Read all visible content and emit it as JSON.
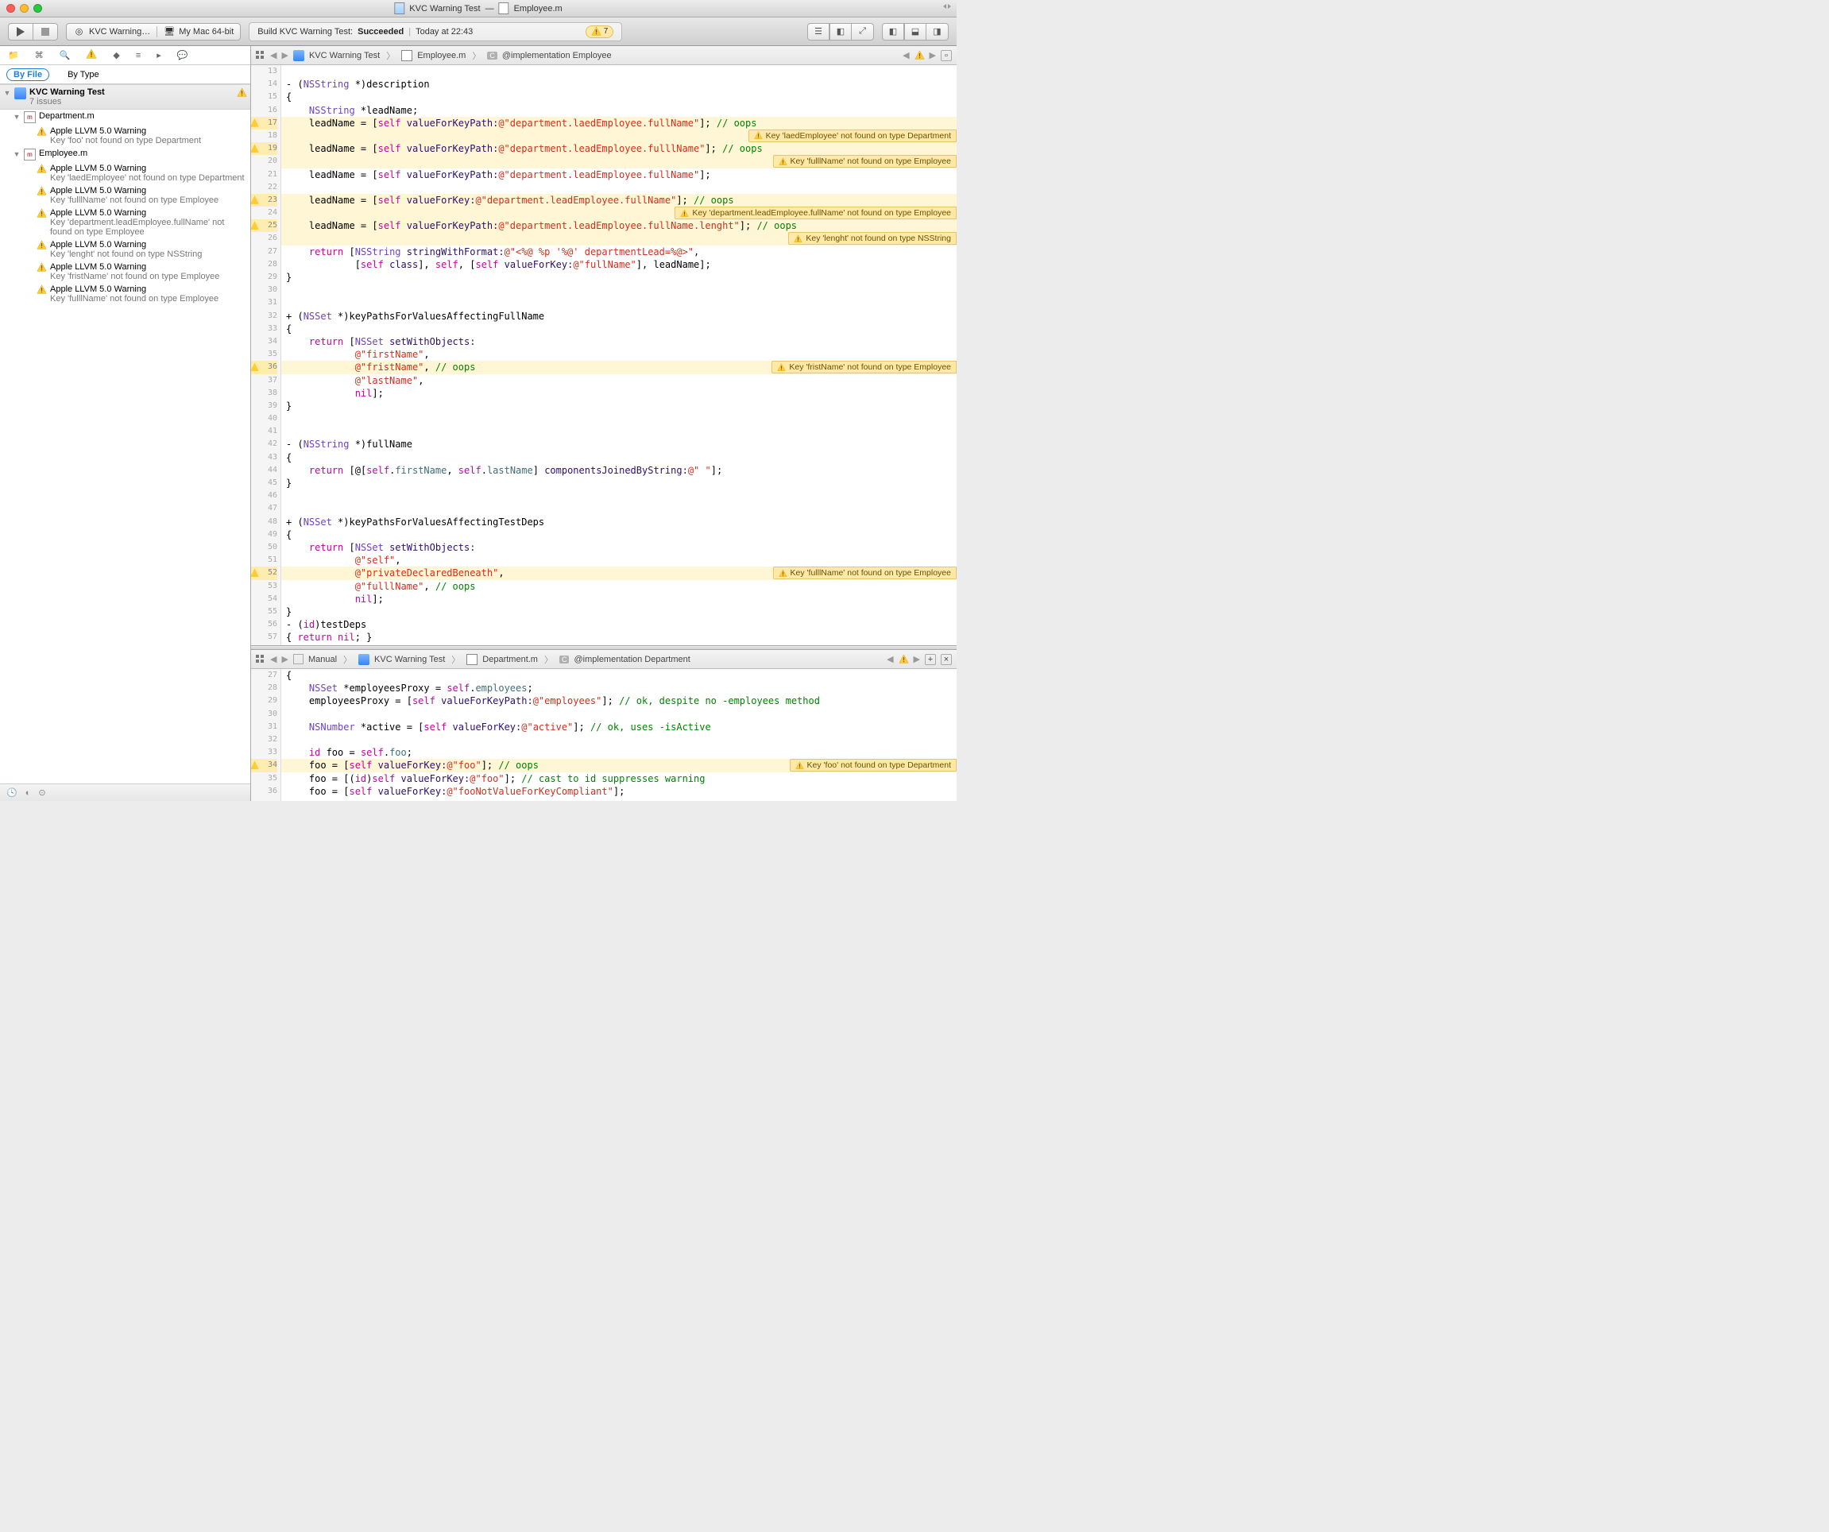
{
  "title": {
    "project": "KVC Warning Test",
    "dash": " — ",
    "file": "Employee.m"
  },
  "toolbar": {
    "scheme": "KVC Warning…",
    "destination": "My Mac 64-bit",
    "activity_prefix": "Build KVC Warning Test: ",
    "activity_status": "Succeeded",
    "activity_time": "Today at 22:43",
    "warn_count": "7"
  },
  "filters": {
    "by_file": "By File",
    "by_type": "By Type"
  },
  "sidebar": {
    "project": "KVC Warning Test",
    "issues": "7 issues",
    "files": [
      {
        "name": "Department.m",
        "items": [
          {
            "title": "Apple LLVM 5.0 Warning",
            "detail": "Key 'foo' not found on type Department"
          }
        ]
      },
      {
        "name": "Employee.m",
        "items": [
          {
            "title": "Apple LLVM 5.0 Warning",
            "detail": "Key 'laedEmployee' not found on type Department"
          },
          {
            "title": "Apple LLVM 5.0 Warning",
            "detail": "Key 'fulllName' not found on type Employee"
          },
          {
            "title": "Apple LLVM 5.0 Warning",
            "detail": "Key 'department.leadEmployee.fullName' not found on type Employee"
          },
          {
            "title": "Apple LLVM 5.0 Warning",
            "detail": "Key 'lenght' not found on type NSString"
          },
          {
            "title": "Apple LLVM 5.0 Warning",
            "detail": "Key 'fristName' not found on type Employee"
          },
          {
            "title": "Apple LLVM 5.0 Warning",
            "detail": "Key 'fulllName' not found on type Employee"
          }
        ]
      }
    ]
  },
  "jump1": {
    "project": "KVC Warning Test",
    "file": "Employee.m",
    "symbol": "@implementation Employee"
  },
  "jump2": {
    "mode": "Manual",
    "project": "KVC Warning Test",
    "file": "Department.m",
    "symbol": "@implementation Department"
  },
  "inline": {
    "w17": "Key 'laedEmployee' not found on type Department",
    "w19": "Key 'fulllName' not found on type Employee",
    "w23": "Key 'department.leadEmployee.fullName' not found on type Employee",
    "w25": "Key 'lenght' not found on type NSString",
    "w36": "Key 'fristName' not found on type Employee",
    "w52": "Key 'fulllName' not found on type Employee",
    "w34b": "Key 'foo' not found on type Department"
  },
  "editor1": {
    "start": 13,
    "lines": [
      "",
      "- (<cls>NSString</cls> *)description",
      "{",
      "    <cls>NSString</cls> *leadName;",
      "    leadName = [<selfc>self</selfc> <msg>valueForKeyPath:</msg><str>@\"department.laedEmployee.fullName\"</str>]; <cmt>// oops</cmt>",
      "",
      "    leadName = [<selfc>self</selfc> <msg>valueForKeyPath:</msg><str>@\"department.leadEmployee.fulllName\"</str>]; <cmt>// oops</cmt>",
      "",
      "    leadName = [<selfc>self</selfc> <msg>valueForKeyPath:</msg><str>@\"department.leadEmployee.fullName\"</str>];",
      "",
      "    leadName = [<selfc>self</selfc> <msg>valueForKey:</msg><str>@\"department.leadEmployee.fullName\"</str>]; <cmt>// oops</cmt>",
      "",
      "    leadName = [<selfc>self</selfc> <msg>valueForKeyPath:</msg><str>@\"department.leadEmployee.fullName.lenght\"</str>]; <cmt>// oops</cmt>",
      "",
      "    <kw>return</kw> [<cls>NSString</cls> <msg>stringWithFormat:</msg><str>@\"&lt;%@ %p '%@' departmentLead=%@&gt;\"</str>,",
      "            [<selfc>self</selfc> <msg>class</msg>], <selfc>self</selfc>, [<selfc>self</selfc> <msg>valueForKey:</msg><str>@\"fullName\"</str>], leadName];",
      "}",
      "",
      "",
      "+ (<cls>NSSet</cls> *)keyPathsForValuesAffectingFullName",
      "{",
      "    <kw>return</kw> [<cls>NSSet</cls> <msg>setWithObjects:</msg>",
      "            <str>@\"firstName\"</str>,",
      "            <str>@\"fristName\"</str>, <cmt>// oops</cmt>",
      "            <str>@\"lastName\"</str>,",
      "            <kw>nil</kw>];",
      "}",
      "",
      "",
      "- (<cls>NSString</cls> *)fullName",
      "{",
      "    <kw>return</kw> [@[<selfc>self</selfc>.<id>firstName</id>, <selfc>self</selfc>.<id>lastName</id>] <msg>componentsJoinedByString:</msg><str>@\" \"</str>];",
      "}",
      "",
      "",
      "+ (<cls>NSSet</cls> *)keyPathsForValuesAffectingTestDeps",
      "{",
      "    <kw>return</kw> [<cls>NSSet</cls> <msg>setWithObjects:</msg>",
      "            <str>@\"self\"</str>,",
      "            <str>@\"privateDeclaredBeneath\"</str>,",
      "            <str>@\"fulllName\"</str>, <cmt>// oops</cmt>",
      "            <kw>nil</kw>];",
      "}",
      "- (<kw>id</kw>)testDeps",
      "{ <kw>return</kw> <kw>nil</kw>; }"
    ],
    "warns": {
      "17": true,
      "19": true,
      "23": true,
      "25": true,
      "36": true,
      "52": true
    },
    "hl": {
      "17": true,
      "18": true,
      "19": true,
      "20": true,
      "23": true,
      "24": true,
      "25": true,
      "26": true,
      "36": true,
      "52": true
    }
  },
  "editor2": {
    "start": 27,
    "lines": [
      "{",
      "    <cls>NSSet</cls> *employeesProxy = <selfc>self</selfc>.<id>employees</id>;",
      "    employeesProxy = [<selfc>self</selfc> <msg>valueForKeyPath:</msg><str>@\"employees\"</str>]; <cmt>// ok, despite no -employees method</cmt>",
      "",
      "    <cls>NSNumber</cls> *active = [<selfc>self</selfc> <msg>valueForKey:</msg><str>@\"active\"</str>]; <cmt>// ok, uses -isActive</cmt>",
      "",
      "    <kw>id</kw> foo = <selfc>self</selfc>.<id>foo</id>;",
      "    foo = [<selfc>self</selfc> <msg>valueForKey:</msg><str>@\"foo\"</str>]; <cmt>// oops</cmt>",
      "    foo = [(<kw>id</kw>)<selfc>self</selfc> <msg>valueForKey:</msg><str>@\"foo\"</str>]; <cmt>// cast to id suppresses warning</cmt>",
      "    foo = [<selfc>self</selfc> <msg>valueForKey:</msg><str>@\"fooNotValueForKeyCompliant\"</str>];"
    ],
    "warns": {
      "34": true
    },
    "hl": {
      "34": true
    }
  }
}
